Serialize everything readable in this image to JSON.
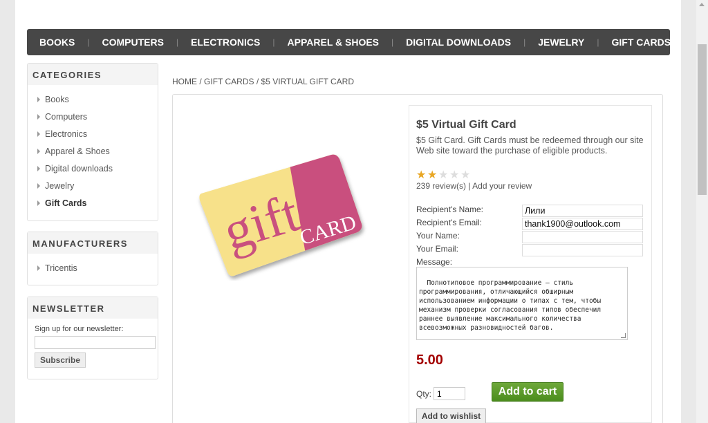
{
  "topmenu": [
    "BOOKS",
    "COMPUTERS",
    "ELECTRONICS",
    "APPAREL & SHOES",
    "DIGITAL DOWNLOADS",
    "JEWELRY",
    "GIFT CARDS"
  ],
  "categories": {
    "title": "CATEGORIES",
    "items": [
      "Books",
      "Computers",
      "Electronics",
      "Apparel & Shoes",
      "Digital downloads",
      "Jewelry",
      "Gift Cards"
    ]
  },
  "manufacturers": {
    "title": "MANUFACTURERS",
    "items": [
      "Tricentis"
    ]
  },
  "newsletter": {
    "title": "NEWSLETTER",
    "label": "Sign up for our newsletter:",
    "button": "Subscribe"
  },
  "breadcrumb": {
    "home": "HOME",
    "sep": "/",
    "category": "GIFT CARDS",
    "current": "$5 VIRTUAL GIFT CARD"
  },
  "product": {
    "title": "$5 Virtual Gift Card",
    "description": "$5 Gift Card. Gift Cards must be redeemed through our site Web site toward the purchase of eligible products.",
    "rating": 2,
    "rating_max": 5,
    "reviews_count": "239 review(s)",
    "reviews_sep": "|",
    "add_review": "Add your review",
    "image_text": {
      "gift": "gift",
      "card": "CARD"
    },
    "colors": {
      "card_yellow": "#f7e18a",
      "card_pink": "#c9507e",
      "price": "#a30000",
      "add_to_cart": "#5a9a2a"
    }
  },
  "form": {
    "recipient_name_label": "Recipient's Name:",
    "recipient_name": "Лили",
    "recipient_email_label": "Recipient's Email:",
    "recipient_email": "thank1900@outlook.com",
    "your_name_label": "Your Name:",
    "your_name": "",
    "your_email_label": "Your Email:",
    "your_email": "",
    "message_label": "Message:",
    "message": "Полнотиповое программирование — стиль\nпрограммирования, отличающийся обширным\nиспользованием информации о типах с тем, чтобы\nмеханизм проверки согласования типов обеспечил\nраннее выявление максимального количества\nвсевозможных разновидностей багов."
  },
  "price": "5.00",
  "qty_label": "Qty:",
  "qty": "1",
  "add_to_cart": "Add to cart",
  "add_to_wishlist": "Add to wishlist"
}
